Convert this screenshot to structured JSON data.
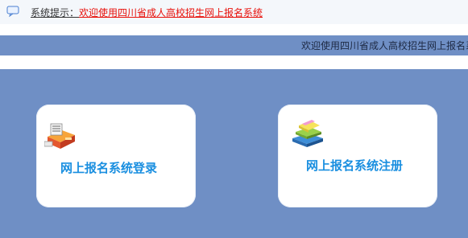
{
  "system_notice": {
    "icon": "speech-bubble-icon",
    "label": "系统提示：",
    "message": "欢迎使用四川省成人高校招生网上报名系统"
  },
  "marquee": {
    "text": "欢迎使用四川省成人高校招生网上报名系统"
  },
  "cards": {
    "login": {
      "icon": "server-box-icon",
      "label": "网上报名系统登录"
    },
    "register": {
      "icon": "stacked-books-icon",
      "label": "网上报名系统注册"
    }
  },
  "colors": {
    "panel_blue": "#6f8fc5",
    "link_red": "#e8120c",
    "card_text_blue": "#1a8fe0"
  }
}
